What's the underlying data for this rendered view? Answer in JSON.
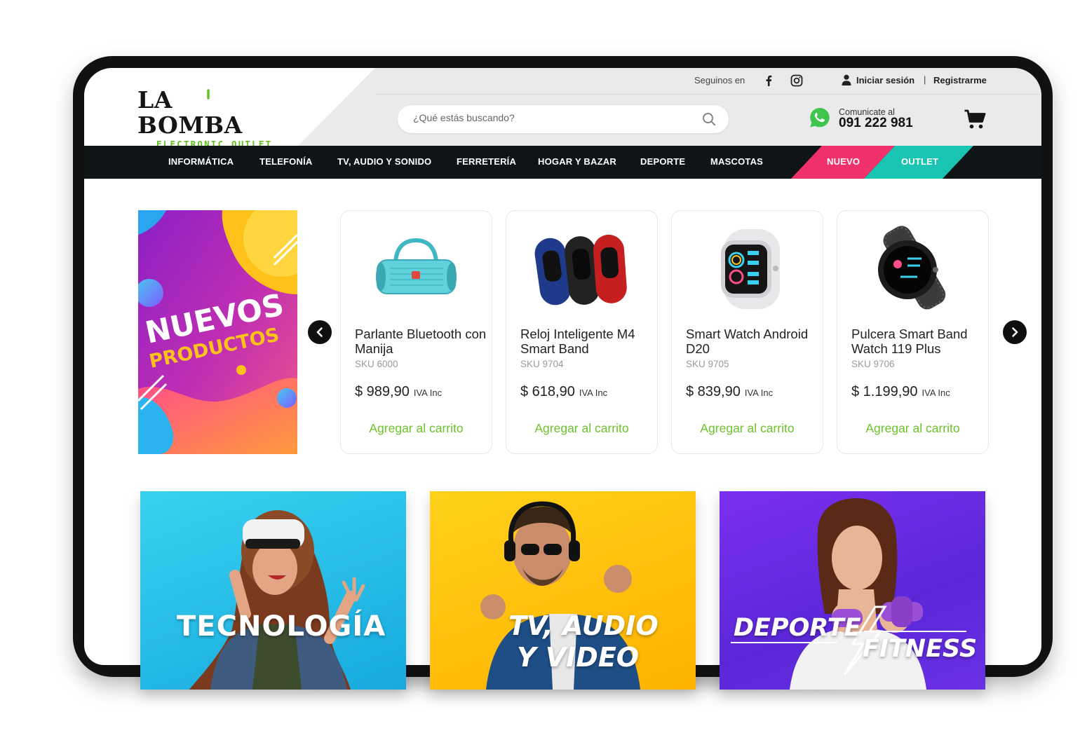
{
  "brand": {
    "name": "LA BOMBA",
    "tagline": "ELECTRONIC OUTLET",
    "accent": "#5cc21a"
  },
  "topbar": {
    "follow_label": "Seguinos en",
    "login": "Iniciar sesión",
    "separator": "|",
    "register": "Registrarme"
  },
  "search": {
    "placeholder": "¿Qué estás buscando?"
  },
  "contact": {
    "label": "Comunicate al",
    "phone": "091 222 981"
  },
  "nav": {
    "items": [
      "INFORMÁTICA",
      "TELEFONÍA",
      "TV, AUDIO Y SONIDO",
      "FERRETERÍA",
      "HOGAR Y BAZAR",
      "DEPORTE",
      "MASCOTAS"
    ],
    "nuevo": "NUEVO",
    "outlet": "OUTLET",
    "nuevo_color": "#f0316c",
    "outlet_color": "#19c4b2"
  },
  "promo": {
    "line1": "NUEVOS",
    "line2": "PRODUCTOS"
  },
  "products": [
    {
      "name": "Parlante Bluetooth con Manija",
      "sku": "SKU 6000",
      "price": "$ 989,90",
      "iva": "IVA Inc",
      "cta": "Agregar al carrito",
      "icon": "speaker-image"
    },
    {
      "name": "Reloj Inteligente M4 Smart Band",
      "sku": "SKU 9704",
      "price": "$ 618,90",
      "iva": "IVA Inc",
      "cta": "Agregar al carrito",
      "icon": "smart-band-image"
    },
    {
      "name": "Smart Watch Android D20",
      "sku": "SKU 9705",
      "price": "$ 839,90",
      "iva": "IVA Inc",
      "cta": "Agregar al carrito",
      "icon": "smart-watch-image"
    },
    {
      "name": "Pulcera Smart Band Watch 119 Plus",
      "sku": "SKU 9706",
      "price": "$ 1.199,90",
      "iva": "IVA Inc",
      "cta": "Agregar al carrito",
      "icon": "round-watch-image"
    }
  ],
  "categories": {
    "tech": "TECNOLOGÍA",
    "audio_1": "TV, AUDIO",
    "audio_2": "Y VIDEO",
    "sport_1": "DEPORTE",
    "sport_2": "FITNESS"
  }
}
